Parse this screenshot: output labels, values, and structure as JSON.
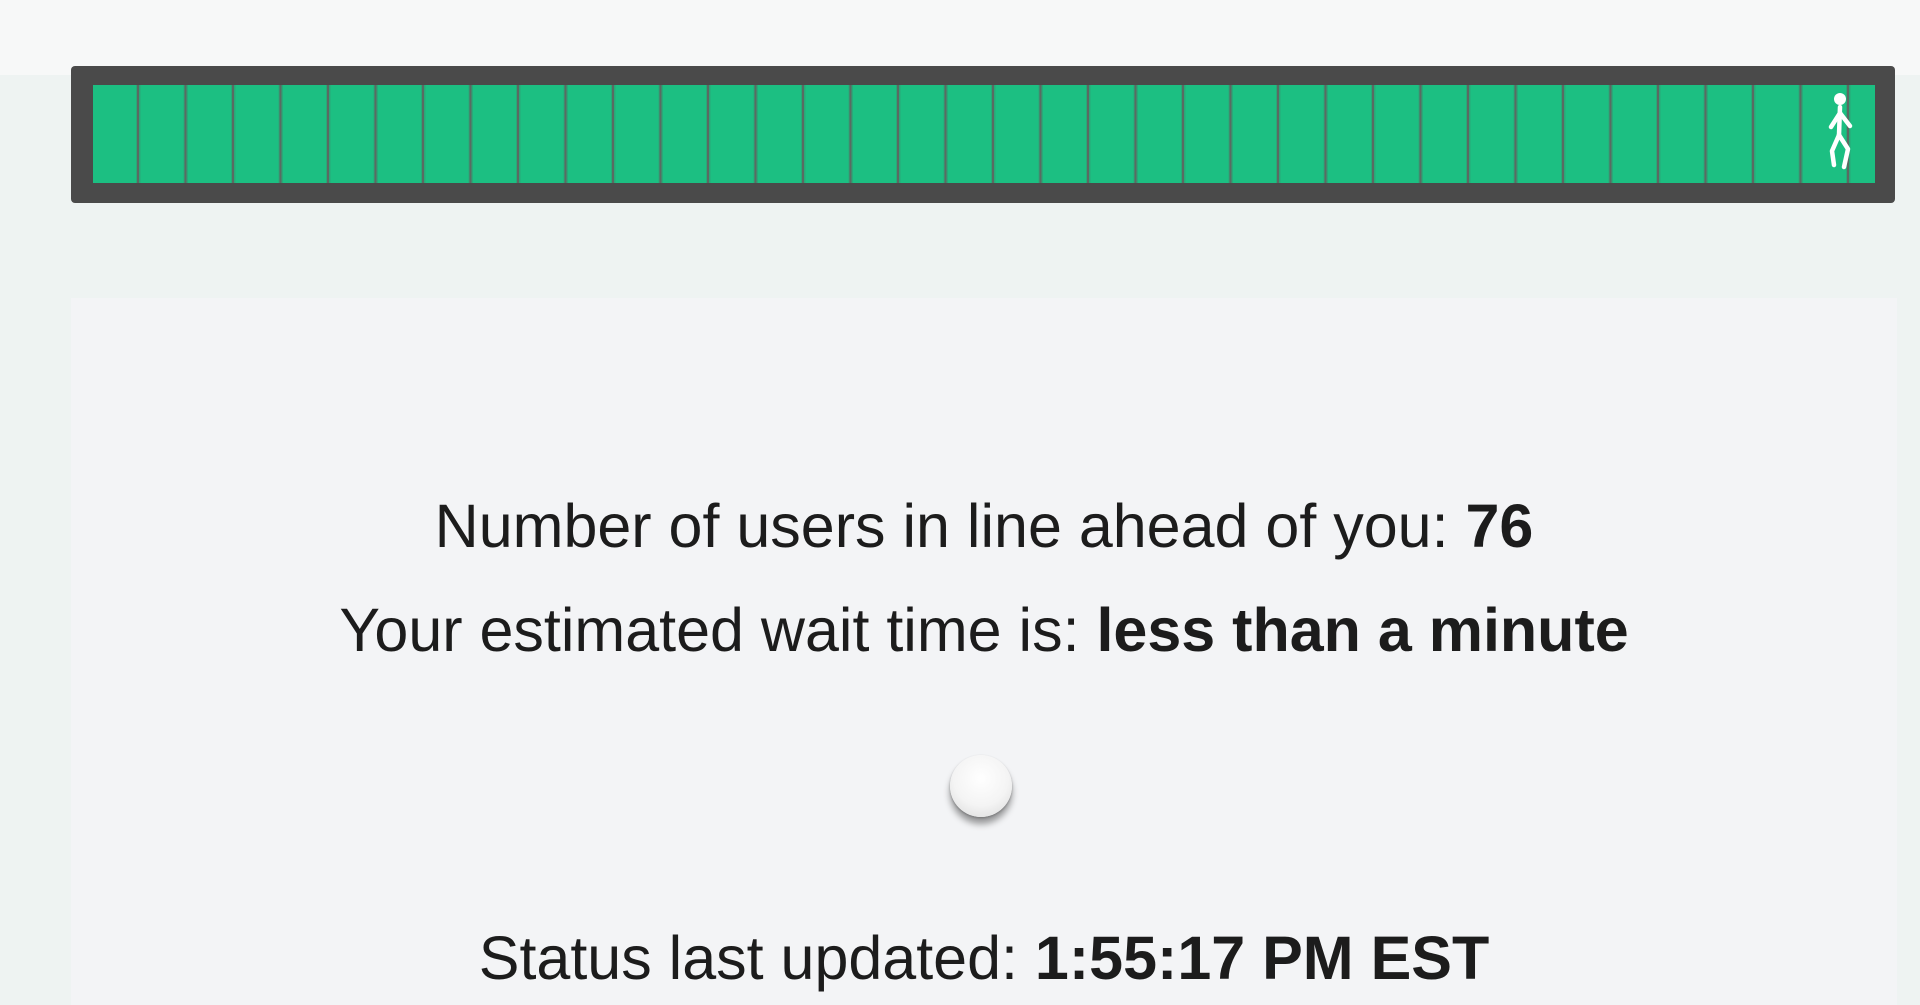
{
  "queue_progress": {
    "percent_complete": 100,
    "walker_icon": "walking-person-icon",
    "fill_color": "#1cbf82",
    "frame_color": "#4a4a4a"
  },
  "status": {
    "queue_label": "Number of users in line ahead of you:",
    "queue_count": "76",
    "wait_label": "Your estimated wait time is:",
    "wait_value": "less than a minute",
    "updated_label": "Status last updated:",
    "updated_time": "1:55:17 PM EST"
  },
  "spinner": {
    "icon": "loading-spinner-icon"
  }
}
